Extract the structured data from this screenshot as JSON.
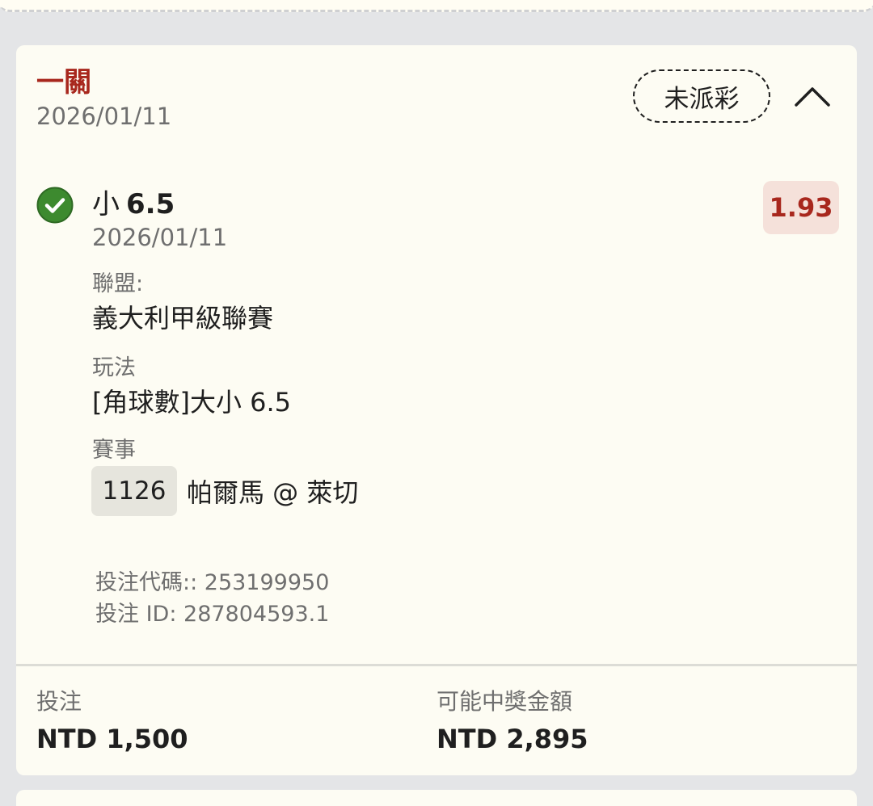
{
  "bet": {
    "type": "一關",
    "date": "2026/01/11",
    "status": "未派彩",
    "collapse_icon": "chevron-up-icon"
  },
  "selection": {
    "status_icon": "check-circle-icon",
    "status_color": "#3d8a2f",
    "pick": "小",
    "line": "6.5",
    "date": "2026/01/11",
    "odds": "1.93",
    "league_label": "聯盟:",
    "league": "義大利甲級聯賽",
    "market_label": "玩法",
    "market": "[角球數]大小 6.5",
    "event_label": "賽事",
    "match_number": "1126",
    "match": "帕爾馬 @ 萊切"
  },
  "codes": {
    "bet_code": "投注代碼:: 253199950",
    "bet_id": "投注 ID: 287804593.1"
  },
  "summary": {
    "stake_label": "投注",
    "stake": "NTD 1,500",
    "payout_label": "可能中獎金額",
    "payout": "NTD 2,895"
  },
  "colors": {
    "accent": "#a8271d",
    "card_background": "#fdfcf3",
    "page_background": "#e4e5e7",
    "odds_background": "#f5e1da"
  }
}
